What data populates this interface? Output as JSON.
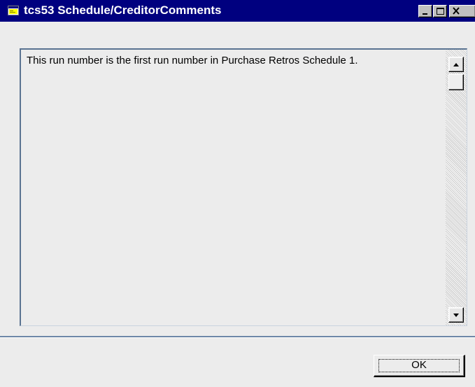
{
  "window": {
    "title": "tcs53 Schedule/CreditorComments",
    "title_icon": "app-window-icon",
    "controls": {
      "minimize_icon": "minimize-icon",
      "maximize_icon": "maximize-icon",
      "close_icon": "close-icon"
    },
    "colors": {
      "titlebar": "#00007f",
      "client": "#ececec"
    }
  },
  "comment": {
    "text": "This run number is the first run number in Purchase Retros Schedule 1."
  },
  "scrollbar": {
    "up_icon": "arrow-up-icon",
    "down_icon": "arrow-down-icon"
  },
  "footer": {
    "ok_label": "OK"
  }
}
